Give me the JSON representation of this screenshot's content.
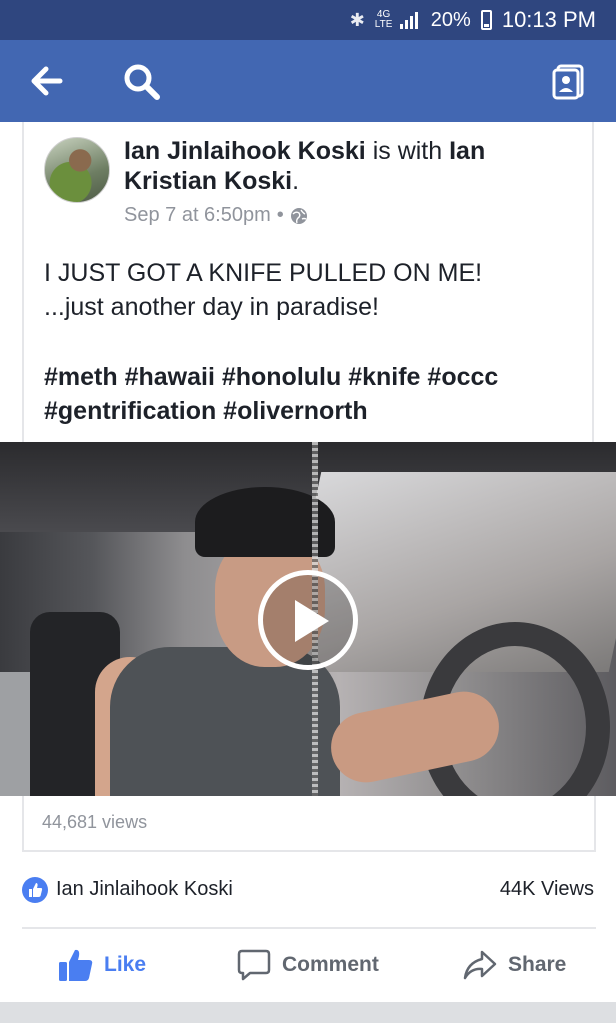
{
  "status_bar": {
    "network": "4G LTE",
    "battery": "20%",
    "time": "10:13 PM"
  },
  "nav": {
    "back_icon": "arrow-left-icon",
    "search_icon": "search-icon",
    "profile_icon": "profile-card-icon"
  },
  "post": {
    "author": "Ian Jinlaihook Koski",
    "with_text": "is with",
    "tagged": "Ian Kristian Koski",
    "timestamp": "Sep 7 at 6:50pm",
    "privacy_icon": "globe-icon",
    "text_line1": "I JUST GOT A KNIFE PULLED ON ME!",
    "text_line2": "...just another day in paradise!",
    "tags_line1": "#meth #hawaii #honolulu #knife #occc",
    "tags_line2": "#gentrification #olivernorth"
  },
  "video": {
    "play_icon": "play-icon",
    "views": "44,681 views"
  },
  "reactions": {
    "icon": "like-badge-icon",
    "name": "Ian Jinlaihook Koski",
    "views_count": "44K Views"
  },
  "actions": {
    "like": "Like",
    "comment": "Comment",
    "share": "Share"
  },
  "colors": {
    "status_bar": "#2f467f",
    "nav_bar": "#4267b2",
    "like_blue": "#4a7ef1",
    "muted": "#90949c"
  }
}
